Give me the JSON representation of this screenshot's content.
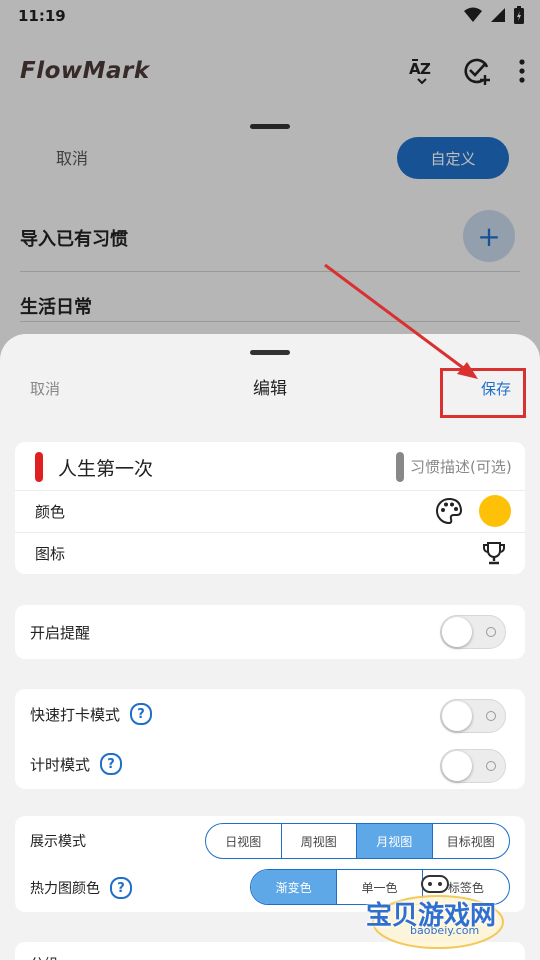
{
  "status": {
    "time": "11:19"
  },
  "app": {
    "title": "FlowMark"
  },
  "background": {
    "cancel_label": "取消",
    "custom_label": "自定义",
    "rows": [
      "导入已有习惯",
      "生活日常"
    ],
    "plus_label": "+"
  },
  "sheet": {
    "cancel_label": "取消",
    "title": "编辑",
    "save_label": "保存",
    "habit_name": "人生第一次",
    "description_placeholder": "习惯描述(可选)",
    "color_label": "颜色",
    "color_value": "#FFC107",
    "icon_label": "图标",
    "icon_name": "trophy-icon",
    "reminder_label": "开启提醒",
    "reminder_on": false,
    "quick_checkin_label": "快速打卡模式",
    "quick_checkin_on": false,
    "timer_label": "计时模式",
    "timer_on": false,
    "help_glyph": "?",
    "display_mode": {
      "label": "展示模式",
      "options": [
        "日视图",
        "周视图",
        "月视图",
        "目标视图"
      ],
      "selected": "月视图"
    },
    "heatmap_color": {
      "label": "热力图颜色",
      "options": [
        "渐变色",
        "单一色",
        "标签色"
      ],
      "selected": "渐变色"
    },
    "partial_label": "分组"
  },
  "watermark": {
    "text": "宝贝游戏网",
    "url": "baobeiy.com"
  },
  "colors": {
    "accent": "#1F6FC8",
    "habit_bar": "#E02020",
    "highlight": "#D93030"
  }
}
